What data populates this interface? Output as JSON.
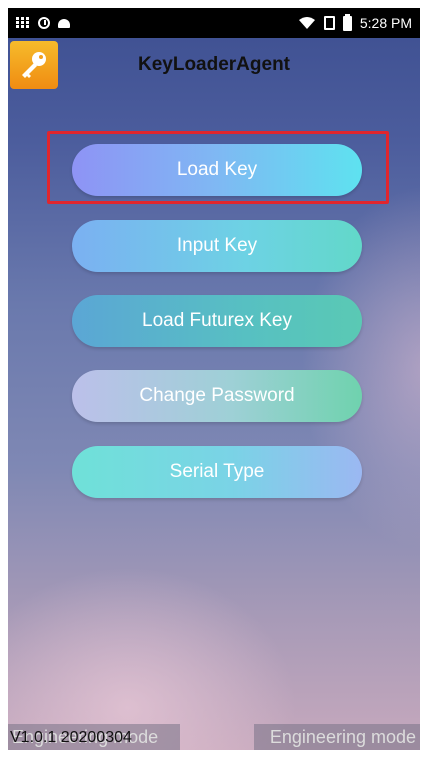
{
  "status_bar": {
    "time": "5:28 PM",
    "left_icons": [
      "grid-icon",
      "clock-icon",
      "android-icon"
    ],
    "right_icons": [
      "wifi-icon",
      "sim-icon",
      "battery-icon"
    ]
  },
  "app_bar": {
    "title": "KeyLoaderAgent",
    "logo_icon": "key-icon",
    "logo_color": "#f3a11d"
  },
  "menu": {
    "buttons": [
      {
        "label": "Load Key"
      },
      {
        "label": "Input Key"
      },
      {
        "label": "Load Futurex Key"
      },
      {
        "label": "Change Password"
      },
      {
        "label": "Serial Type"
      }
    ],
    "highlight_color": "#e0262e"
  },
  "footer": {
    "version": "V1.0.1 20200304",
    "engineering_left": "Engineering mode",
    "engineering_right": "Engineering mode"
  }
}
